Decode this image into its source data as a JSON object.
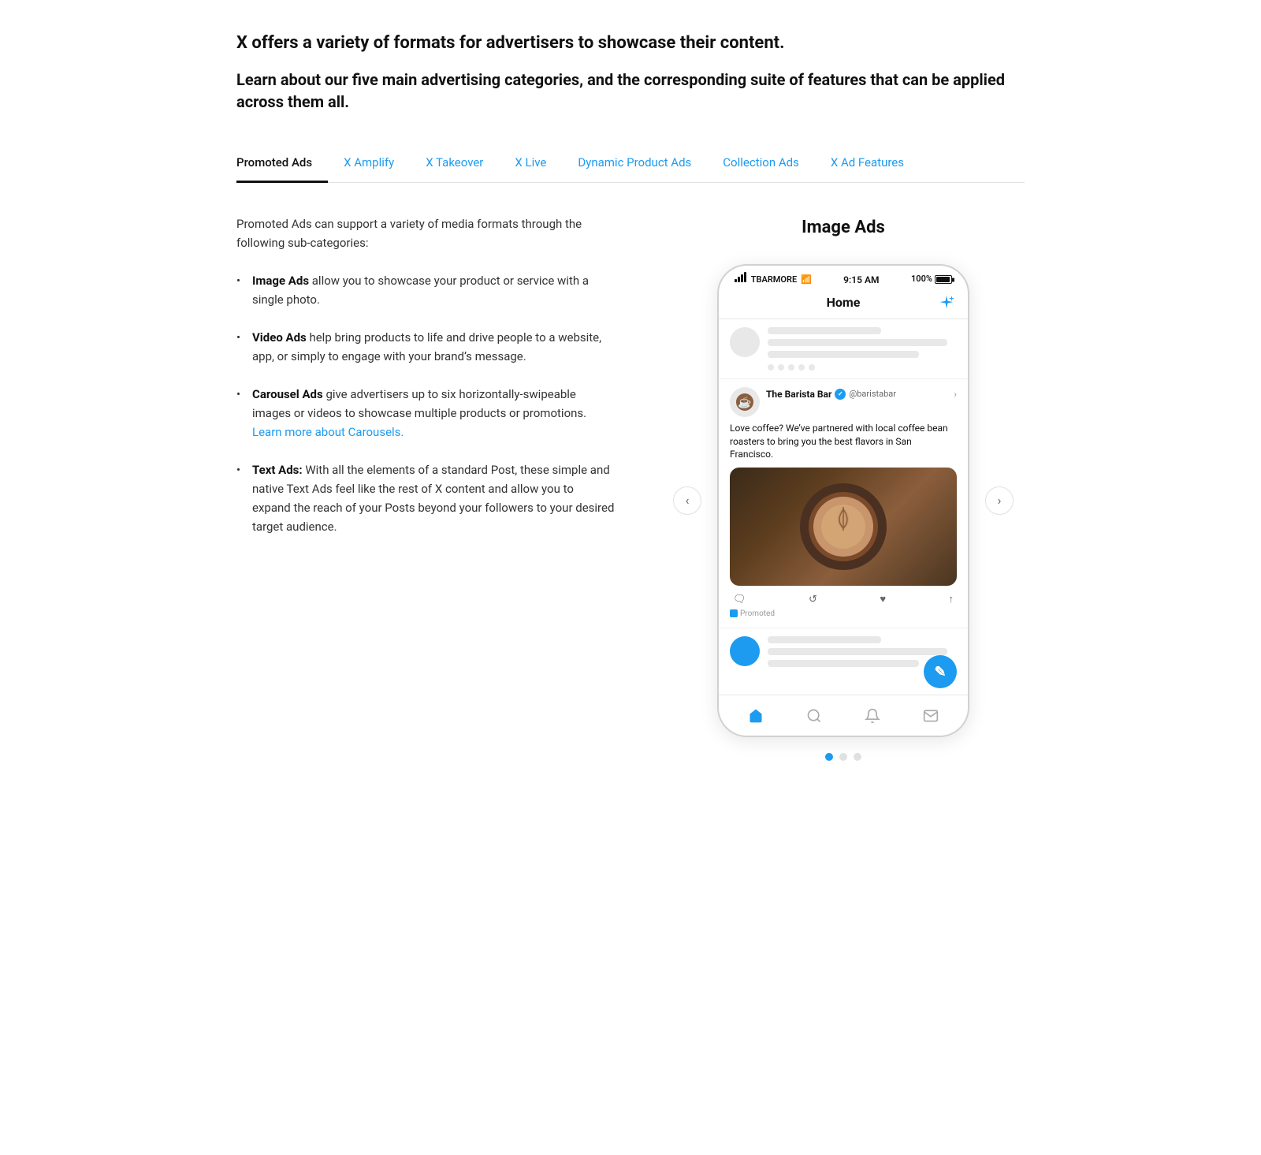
{
  "intro": {
    "headline": "X offers a variety of formats for advertisers to showcase their content.",
    "subheadline": "Learn about our five main advertising categories, and the corresponding suite of features that can be applied across them all."
  },
  "tabs": {
    "items": [
      {
        "label": "Promoted Ads",
        "active": true
      },
      {
        "label": "X Amplify",
        "active": false
      },
      {
        "label": "X Takeover",
        "active": false
      },
      {
        "label": "X Live",
        "active": false
      },
      {
        "label": "Dynamic Product Ads",
        "active": false
      },
      {
        "label": "Collection Ads",
        "active": false
      },
      {
        "label": "X Ad Features",
        "active": false
      }
    ]
  },
  "content": {
    "description": "Promoted Ads can support a variety of media formats through the following sub-categories:",
    "features": [
      {
        "title": "Image Ads",
        "text": " allow you to showcase your product or service with a single photo."
      },
      {
        "title": "Video Ads",
        "text": " help bring products to life and drive people to a website, app, or simply to engage with your brand’s message."
      },
      {
        "title": "Carousel Ads",
        "text": " give advertisers up to six horizontally-swipeable images or videos to showcase multiple products or promotions.",
        "link_text": "Learn more about Carousels.",
        "link_href": "#"
      },
      {
        "title": "Text Ads:",
        "text": " With all the elements of a standard Post, these simple and native Text Ads feel like the rest of X content and allow you to expand the reach of your Posts beyond your followers to your desired target audience."
      }
    ],
    "preview_title": "Image Ads",
    "phone": {
      "carrier": "TBARMORE",
      "time": "9:15 AM",
      "battery": "100%",
      "nav_title": "Home",
      "post": {
        "author_name": "The Barista Bar",
        "handle": "@baristabar",
        "text": "Love coffee? We’ve partnered with local coffee bean roasters to bring you the best flavors in San Francisco.",
        "promoted_label": "Promoted"
      }
    },
    "carousel_arrows": {
      "prev": "‹",
      "next": "›"
    },
    "dots": [
      {
        "active": true
      },
      {
        "active": false
      },
      {
        "active": false
      }
    ]
  }
}
